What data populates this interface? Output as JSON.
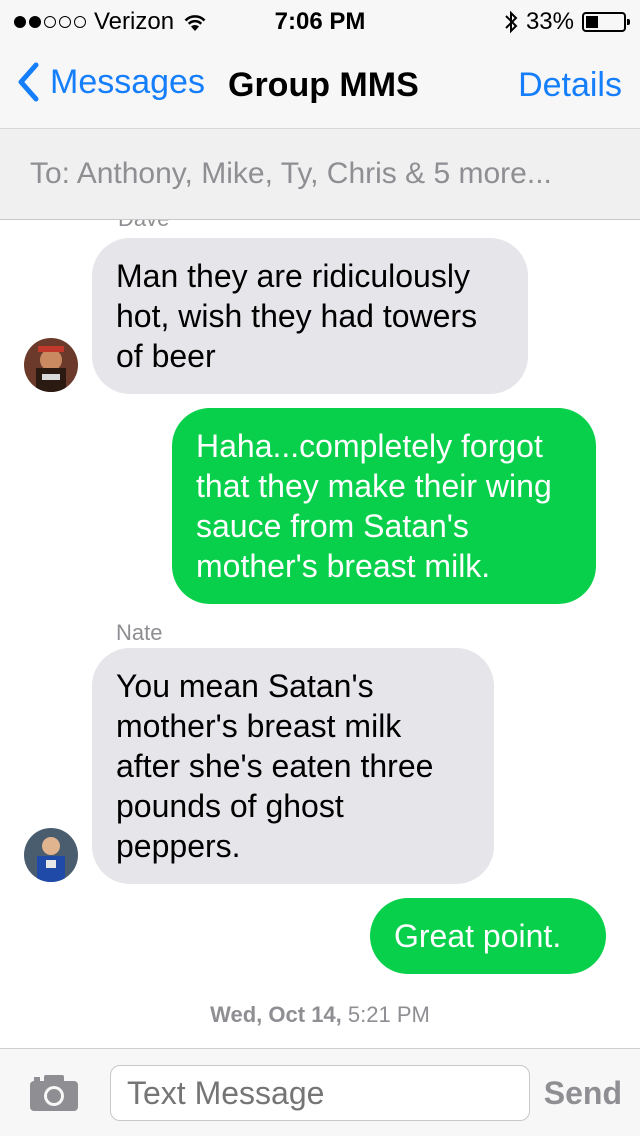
{
  "status_bar": {
    "carrier": "Verizon",
    "signal_bars_filled": 2,
    "signal_bars_total": 5,
    "time": "7:06 PM",
    "battery_percent": "33%",
    "battery_level": 0.33
  },
  "nav": {
    "back_label": "Messages",
    "title": "Group MMS",
    "details_label": "Details"
  },
  "to_field": {
    "text": "To: Anthony, Mike, Ty, Chris & 5 more..."
  },
  "thread": {
    "cut_sender": "Dave",
    "messages": [
      {
        "direction": "incoming",
        "text": "Man they are ridiculously hot, wish they had towers of beer"
      },
      {
        "direction": "outgoing",
        "text": "Haha...completely forgot that they make their wing sauce from Satan's mother's breast milk."
      },
      {
        "direction": "incoming",
        "sender": "Nate",
        "text": "You mean Satan's mother's breast milk after she's eaten three pounds of ghost peppers."
      },
      {
        "direction": "outgoing",
        "text": "Great point."
      }
    ],
    "timestamp_day": "Wed, Oct 14,",
    "timestamp_time": "5:21 PM"
  },
  "input_bar": {
    "placeholder": "Text Message",
    "send_label": "Send"
  },
  "colors": {
    "accent": "#157efb",
    "outgoing_bubble": "#08d04b",
    "incoming_bubble": "#e5e5ea"
  }
}
